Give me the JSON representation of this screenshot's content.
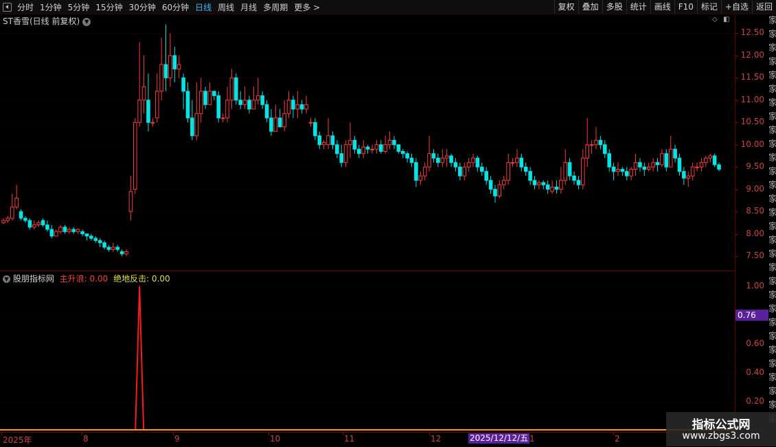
{
  "toolbar": {
    "tabs": [
      "分时",
      "1分钟",
      "5分钟",
      "15分钟",
      "30分钟",
      "60分钟",
      "日线",
      "周线",
      "月线",
      "多周期",
      "更多 >"
    ],
    "active_tab": "日线",
    "tools": [
      "复权",
      "叠加",
      "多股",
      "统计",
      "画线",
      "F10",
      "标记",
      "+自选",
      "返回"
    ]
  },
  "main_chart": {
    "title": "ST香雪(日线 前复权)",
    "y_ticks": [
      "12.50",
      "12.00",
      "11.50",
      "11.00",
      "10.50",
      "10.00",
      "9.50",
      "9.00",
      "8.50",
      "8.00",
      "7.50"
    ]
  },
  "sub_chart": {
    "name": "股朋指标网",
    "line1_label": "主升浪: 0.00",
    "line2_label": "绝地反击: 0.00",
    "y_ticks": [
      "1.00",
      "0.80",
      "0.60",
      "0.40",
      "0.20"
    ],
    "current_value": "0.76"
  },
  "x_axis": {
    "labels": [
      "2025年",
      "8",
      "9",
      "10",
      "11",
      "12",
      "1",
      "2"
    ],
    "cursor_date": "2025/12/12/五"
  },
  "watermark": {
    "title": "指标公式网",
    "url": "www.zbgs3.com"
  },
  "colors": {
    "up": "#ff3b3b",
    "down": "#00e5e5",
    "indicator": "#ff1a1a",
    "label_yellow": "#e0e040",
    "grid": "#4a0000",
    "cursor_bg": "#5b1fa0"
  },
  "chart_data": {
    "type": "candlestick",
    "title": "ST香雪(日线 前复权)",
    "ylim": [
      7.3,
      12.8
    ],
    "candles": [
      [
        8.25,
        8.3,
        8.22,
        8.35
      ],
      [
        8.3,
        8.35,
        8.25,
        8.4
      ],
      [
        8.35,
        8.6,
        8.3,
        8.9
      ],
      [
        8.6,
        8.8,
        8.55,
        9.1
      ],
      [
        8.5,
        8.35,
        8.3,
        8.55
      ],
      [
        8.35,
        8.3,
        8.25,
        8.4
      ],
      [
        8.3,
        8.15,
        8.1,
        8.35
      ],
      [
        8.15,
        8.2,
        8.1,
        8.3
      ],
      [
        8.2,
        8.25,
        8.15,
        8.3
      ],
      [
        8.3,
        8.2,
        8.15,
        8.35
      ],
      [
        8.2,
        8.1,
        8.05,
        8.3
      ],
      [
        8.1,
        7.95,
        7.9,
        8.2
      ],
      [
        7.95,
        8.05,
        7.95,
        8.1
      ],
      [
        8.05,
        8.15,
        8.0,
        8.2
      ],
      [
        8.15,
        8.05,
        8.0,
        8.2
      ],
      [
        8.05,
        8.1,
        8.0,
        8.15
      ],
      [
        8.1,
        8.05,
        8.0,
        8.15
      ],
      [
        8.05,
        8.1,
        8.0,
        8.12
      ],
      [
        8.05,
        8.0,
        7.95,
        8.1
      ],
      [
        8.0,
        7.95,
        7.85,
        8.0
      ],
      [
        7.95,
        7.9,
        7.85,
        8.0
      ],
      [
        7.9,
        7.85,
        7.8,
        7.95
      ],
      [
        7.85,
        7.8,
        7.7,
        7.9
      ],
      [
        7.8,
        7.7,
        7.65,
        7.85
      ],
      [
        7.7,
        7.65,
        7.6,
        7.75
      ],
      [
        7.65,
        7.7,
        7.6,
        7.8
      ],
      [
        7.7,
        7.65,
        7.6,
        7.75
      ],
      [
        7.6,
        7.55,
        7.5,
        7.65
      ],
      [
        7.55,
        7.6,
        7.5,
        7.65
      ],
      [
        8.5,
        8.95,
        8.3,
        9.3
      ],
      [
        9.0,
        10.5,
        8.9,
        10.6
      ],
      [
        10.5,
        11.0,
        10.4,
        12.3
      ],
      [
        11.0,
        11.3,
        10.7,
        12.0
      ],
      [
        11.0,
        10.5,
        10.3,
        11.6
      ],
      [
        10.5,
        10.5,
        10.4,
        10.6
      ],
      [
        10.6,
        11.2,
        10.5,
        11.6
      ],
      [
        11.2,
        11.8,
        11.0,
        12.4
      ],
      [
        11.8,
        11.5,
        11.2,
        12.7
      ],
      [
        11.5,
        12.0,
        11.3,
        12.5
      ],
      [
        12.0,
        11.7,
        11.4,
        12.2
      ],
      [
        11.7,
        11.8,
        11.5,
        12.0
      ],
      [
        11.5,
        11.2,
        10.8,
        11.6
      ],
      [
        11.2,
        10.6,
        10.5,
        11.4
      ],
      [
        10.6,
        10.2,
        10.1,
        11.0
      ],
      [
        10.2,
        10.7,
        10.1,
        11.4
      ],
      [
        10.7,
        11.2,
        10.5,
        11.5
      ],
      [
        11.2,
        10.9,
        10.8,
        11.3
      ],
      [
        10.9,
        11.2,
        10.9,
        11.4
      ],
      [
        11.2,
        11.1,
        11.0,
        11.2
      ],
      [
        11.1,
        10.6,
        10.5,
        11.2
      ],
      [
        10.6,
        10.6,
        10.5,
        10.7
      ],
      [
        10.6,
        11.0,
        10.5,
        11.3
      ],
      [
        11.0,
        11.5,
        10.8,
        11.7
      ],
      [
        11.5,
        11.0,
        10.9,
        11.6
      ],
      [
        11.0,
        10.9,
        10.8,
        11.2
      ],
      [
        10.9,
        11.0,
        10.8,
        11.3
      ],
      [
        11.0,
        10.8,
        10.7,
        11.1
      ],
      [
        10.8,
        11.0,
        10.8,
        11.3
      ],
      [
        11.0,
        11.1,
        10.9,
        11.5
      ],
      [
        11.1,
        10.9,
        10.8,
        11.2
      ],
      [
        10.9,
        10.6,
        10.5,
        11.0
      ],
      [
        10.6,
        10.3,
        10.2,
        10.8
      ],
      [
        10.3,
        10.6,
        10.3,
        10.9
      ],
      [
        10.6,
        10.4,
        10.4,
        10.8
      ],
      [
        10.4,
        10.7,
        10.3,
        11.0
      ],
      [
        10.7,
        11.0,
        10.6,
        11.2
      ],
      [
        11.0,
        10.8,
        10.6,
        11.1
      ],
      [
        10.8,
        10.9,
        10.6,
        11.2
      ],
      [
        10.9,
        10.8,
        10.7,
        11.0
      ],
      [
        10.8,
        10.9,
        10.7,
        11.1
      ],
      [
        10.5,
        10.5,
        10.4,
        10.6
      ],
      [
        10.5,
        10.2,
        10.1,
        10.6
      ],
      [
        10.2,
        10.0,
        9.9,
        10.3
      ],
      [
        10.0,
        10.05,
        9.9,
        10.1
      ],
      [
        10.0,
        10.2,
        9.9,
        10.6
      ],
      [
        10.2,
        10.0,
        9.9,
        10.3
      ],
      [
        10.0,
        9.8,
        9.7,
        10.1
      ],
      [
        9.8,
        9.6,
        9.5,
        10.0
      ],
      [
        9.6,
        10.0,
        9.5,
        10.1
      ],
      [
        10.0,
        10.1,
        9.7,
        10.5
      ],
      [
        10.1,
        9.9,
        9.8,
        10.2
      ],
      [
        9.9,
        9.8,
        9.7,
        10.0
      ],
      [
        9.8,
        9.95,
        9.7,
        10.1
      ],
      [
        9.95,
        9.9,
        9.8,
        10.0
      ],
      [
        9.9,
        9.9,
        9.8,
        10.0
      ],
      [
        9.9,
        10.0,
        9.8,
        10.1
      ],
      [
        10.0,
        9.85,
        9.8,
        10.1
      ],
      [
        9.85,
        10.0,
        9.8,
        10.2
      ],
      [
        10.0,
        10.1,
        9.9,
        10.3
      ],
      [
        10.1,
        10.0,
        9.9,
        10.2
      ],
      [
        10.0,
        9.85,
        9.8,
        10.0
      ],
      [
        9.85,
        9.8,
        9.7,
        9.9
      ],
      [
        9.8,
        9.7,
        9.6,
        9.85
      ],
      [
        9.7,
        9.6,
        9.5,
        9.8
      ],
      [
        9.6,
        9.2,
        9.05,
        9.7
      ],
      [
        9.2,
        9.3,
        9.1,
        9.4
      ],
      [
        9.3,
        9.5,
        9.2,
        9.6
      ],
      [
        9.5,
        9.8,
        9.4,
        10.2
      ],
      [
        9.8,
        9.7,
        9.6,
        9.9
      ],
      [
        9.7,
        9.6,
        9.5,
        9.8
      ],
      [
        9.6,
        9.7,
        9.5,
        9.9
      ],
      [
        9.7,
        9.75,
        9.5,
        9.9
      ],
      [
        9.75,
        9.6,
        9.5,
        9.8
      ],
      [
        9.6,
        9.5,
        9.4,
        9.7
      ],
      [
        9.5,
        9.3,
        9.2,
        9.6
      ],
      [
        9.3,
        9.5,
        9.2,
        9.6
      ],
      [
        9.5,
        9.6,
        9.4,
        9.7
      ],
      [
        9.6,
        9.7,
        9.5,
        9.8
      ],
      [
        9.7,
        9.5,
        9.4,
        9.75
      ],
      [
        9.5,
        9.4,
        9.3,
        9.6
      ],
      [
        9.4,
        9.2,
        9.1,
        9.5
      ],
      [
        9.2,
        9.0,
        8.9,
        9.3
      ],
      [
        9.0,
        8.85,
        8.7,
        9.1
      ],
      [
        8.85,
        9.1,
        8.8,
        9.2
      ],
      [
        9.1,
        9.2,
        9.0,
        9.3
      ],
      [
        9.2,
        9.6,
        9.1,
        9.8
      ],
      [
        9.6,
        9.6,
        9.5,
        9.7
      ],
      [
        9.6,
        9.7,
        9.5,
        9.9
      ],
      [
        9.7,
        9.5,
        9.4,
        9.8
      ],
      [
        9.5,
        9.4,
        9.3,
        9.6
      ],
      [
        9.4,
        9.2,
        9.1,
        9.5
      ],
      [
        9.2,
        9.1,
        9.0,
        9.3
      ],
      [
        9.1,
        9.15,
        9.0,
        9.2
      ],
      [
        9.15,
        9.1,
        9.0,
        9.2
      ],
      [
        9.1,
        9.0,
        8.9,
        9.2
      ],
      [
        8.95,
        9.05,
        8.9,
        9.2
      ],
      [
        9.05,
        9.0,
        8.9,
        9.2
      ],
      [
        9.0,
        9.2,
        8.9,
        9.5
      ],
      [
        9.2,
        9.6,
        9.1,
        9.9
      ],
      [
        9.6,
        9.3,
        9.2,
        9.7
      ],
      [
        9.3,
        9.2,
        9.1,
        9.4
      ],
      [
        9.2,
        9.1,
        9.0,
        9.3
      ],
      [
        9.1,
        9.7,
        9.0,
        9.9
      ],
      [
        9.7,
        10.0,
        9.5,
        10.6
      ],
      [
        10.0,
        10.0,
        9.8,
        10.1
      ],
      [
        10.0,
        10.1,
        9.9,
        10.4
      ],
      [
        10.1,
        10.0,
        9.9,
        10.2
      ],
      [
        10.0,
        9.8,
        9.7,
        10.1
      ],
      [
        9.8,
        9.5,
        9.4,
        9.9
      ],
      [
        9.5,
        9.4,
        9.2,
        9.6
      ],
      [
        9.4,
        9.45,
        9.3,
        9.6
      ],
      [
        9.45,
        9.4,
        9.3,
        9.5
      ],
      [
        9.4,
        9.3,
        9.2,
        9.5
      ],
      [
        9.3,
        9.45,
        9.2,
        9.5
      ],
      [
        9.45,
        9.6,
        9.3,
        9.8
      ],
      [
        9.6,
        9.5,
        9.4,
        9.7
      ],
      [
        9.5,
        9.45,
        9.3,
        9.6
      ],
      [
        9.45,
        9.5,
        9.4,
        9.6
      ],
      [
        9.5,
        9.6,
        9.4,
        9.7
      ],
      [
        9.6,
        9.55,
        9.4,
        9.7
      ],
      [
        9.55,
        9.8,
        9.5,
        9.9
      ],
      [
        9.8,
        9.5,
        9.4,
        9.9
      ],
      [
        9.5,
        9.9,
        9.5,
        10.2
      ],
      [
        9.9,
        9.7,
        9.6,
        10.0
      ],
      [
        9.7,
        9.4,
        9.3,
        9.8
      ],
      [
        9.4,
        9.25,
        9.1,
        9.5
      ],
      [
        9.25,
        9.3,
        9.05,
        9.4
      ],
      [
        9.3,
        9.5,
        9.2,
        9.6
      ],
      [
        9.5,
        9.5,
        9.4,
        9.6
      ],
      [
        9.5,
        9.6,
        9.4,
        9.7
      ],
      [
        9.6,
        9.7,
        9.5,
        9.75
      ],
      [
        9.7,
        9.75,
        9.6,
        9.8
      ],
      [
        9.75,
        9.55,
        9.5,
        9.8
      ],
      [
        9.55,
        9.45,
        9.4,
        9.6
      ]
    ],
    "indicator_series": [
      {
        "name": "主升浪",
        "values_note": "spike to 1.00 at the breakout bar, 0.00 elsewhere"
      },
      {
        "name": "绝地反击",
        "values": [
          0.0
        ]
      }
    ],
    "indicator_spike_index": 31
  }
}
